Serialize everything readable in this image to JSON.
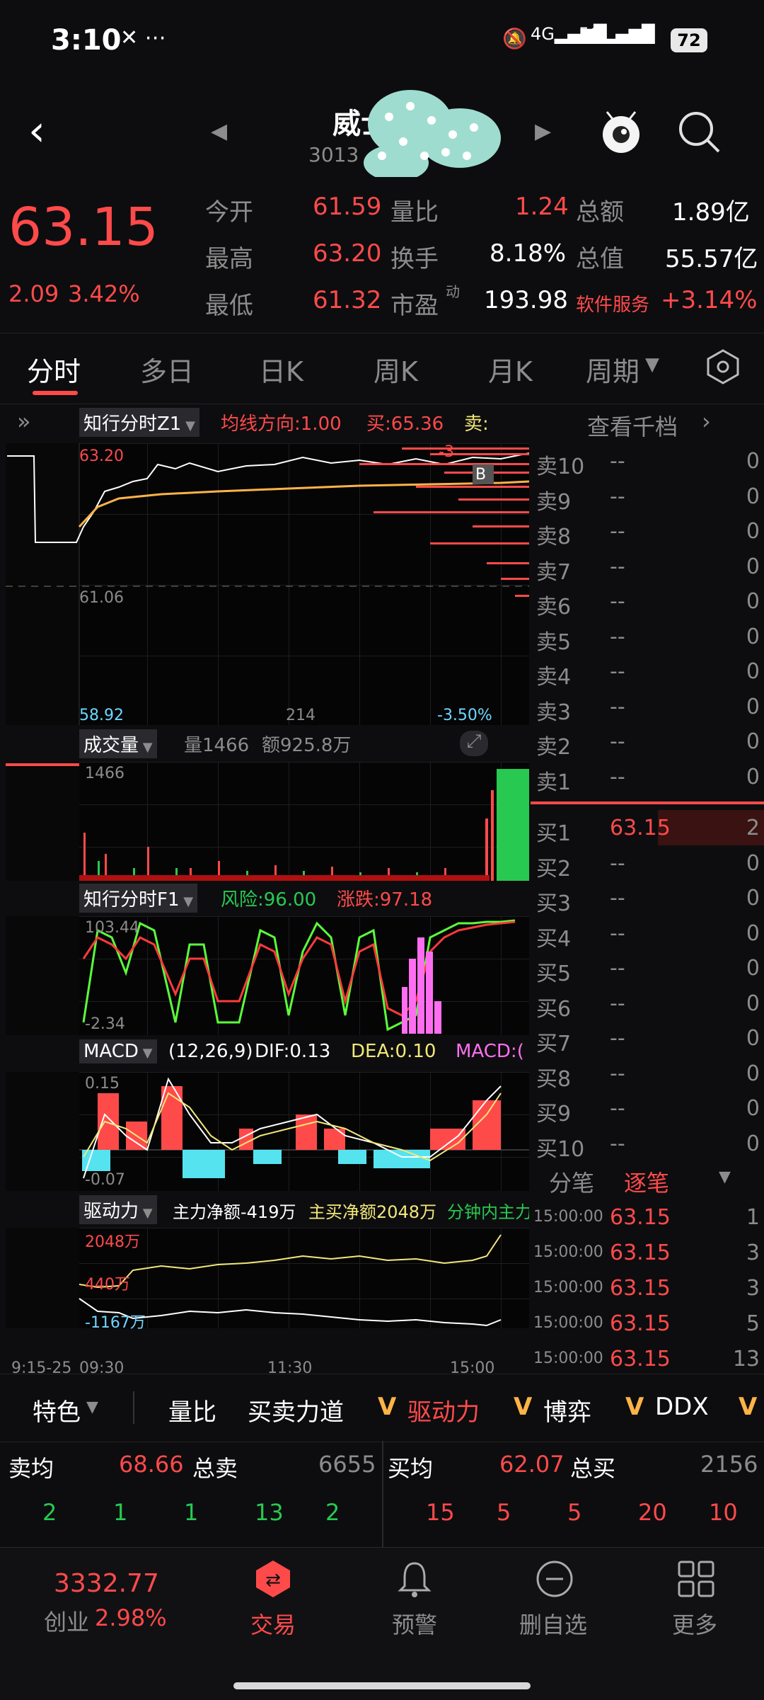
{
  "status": {
    "time": "3:10",
    "battery": "72"
  },
  "nav": {
    "title": "威士",
    "code": "3013"
  },
  "quote": {
    "price": "63.15",
    "change": "2.09",
    "pct": "3.42%",
    "r1": [
      {
        "k": "今开",
        "v": "61.59"
      },
      {
        "k": "量比",
        "v": "1.24"
      },
      {
        "k": "总额",
        "v": "1.89亿"
      }
    ],
    "r2": [
      {
        "k": "最高",
        "v": "63.20"
      },
      {
        "k": "换手",
        "v": "8.18%"
      },
      {
        "k": "总值",
        "v": "55.57亿"
      }
    ],
    "r3": [
      {
        "k": "最低",
        "v": "61.32"
      },
      {
        "k": "市盈",
        "v": "193.98"
      },
      {
        "k": "软件服务",
        "v": "+3.14%"
      }
    ],
    "pe_sup": "动"
  },
  "tabs": [
    "分时",
    "多日",
    "日K",
    "周K",
    "月K",
    "周期"
  ],
  "chart1": {
    "name": "知行分时Z1",
    "avgdir": "均线方向:1.00",
    "buy": "买:65.36",
    "sell": "卖:",
    "view_depth": "查看千档",
    "top": "63.20",
    "mid": "61.06",
    "bottom": "58.92",
    "xmid": "214",
    "pct": "-3.50%",
    "badge": "B",
    "sell_tag": "-3"
  },
  "volume": {
    "name": "成交量",
    "qty": "量1466",
    "amt": "额925.8万",
    "max": "1466"
  },
  "f1": {
    "name": "知行分时F1",
    "risk": "风险:96.00",
    "rise": "涨跌:97.18",
    "top": "103.44",
    "bot": "-2.34"
  },
  "macd": {
    "name": "MACD",
    "params": "(12,26,9)",
    "dif": "DIF:0.13",
    "dea": "DEA:0.10",
    "macd": "MACD:(",
    "top": "0.15",
    "bot": "-0.07"
  },
  "drive": {
    "name": "驱动力",
    "main": "主力净额-419万",
    "mainbuy": "主买净额2048万",
    "minute": "分钟内主力",
    "top": "2048万",
    "mid": "440万",
    "bot": "-1167万"
  },
  "time_axis": [
    "9:15-25",
    "09:30",
    "11:30",
    "15:00"
  ],
  "book": {
    "sell": [
      {
        "l": "卖10",
        "p": "--",
        "v": "0"
      },
      {
        "l": "卖9",
        "p": "--",
        "v": "0"
      },
      {
        "l": "卖8",
        "p": "--",
        "v": "0"
      },
      {
        "l": "卖7",
        "p": "--",
        "v": "0"
      },
      {
        "l": "卖6",
        "p": "--",
        "v": "0"
      },
      {
        "l": "卖5",
        "p": "--",
        "v": "0"
      },
      {
        "l": "卖4",
        "p": "--",
        "v": "0"
      },
      {
        "l": "卖3",
        "p": "--",
        "v": "0"
      },
      {
        "l": "卖2",
        "p": "--",
        "v": "0"
      },
      {
        "l": "卖1",
        "p": "--",
        "v": "0"
      }
    ],
    "buy": [
      {
        "l": "买1",
        "p": "63.15",
        "v": "2"
      },
      {
        "l": "买2",
        "p": "--",
        "v": "0"
      },
      {
        "l": "买3",
        "p": "--",
        "v": "0"
      },
      {
        "l": "买4",
        "p": "--",
        "v": "0"
      },
      {
        "l": "买5",
        "p": "--",
        "v": "0"
      },
      {
        "l": "买6",
        "p": "--",
        "v": "0"
      },
      {
        "l": "买7",
        "p": "--",
        "v": "0"
      },
      {
        "l": "买8",
        "p": "--",
        "v": "0"
      },
      {
        "l": "买9",
        "p": "--",
        "v": "0"
      },
      {
        "l": "买10",
        "p": "--",
        "v": "0"
      }
    ],
    "tab_trades": "分笔",
    "tab_each": "逐笔",
    "ticks": [
      {
        "t": "15:00:00",
        "p": "63.15",
        "v": "1"
      },
      {
        "t": "15:00:00",
        "p": "63.15",
        "v": "3"
      },
      {
        "t": "15:00:00",
        "p": "63.15",
        "v": "3"
      },
      {
        "t": "15:00:00",
        "p": "63.15",
        "v": "5"
      },
      {
        "t": "15:00:00",
        "p": "63.15",
        "v": "13"
      }
    ]
  },
  "features": {
    "special": "特色",
    "items": [
      "量比",
      "买卖力道",
      "驱动力",
      "博弈",
      "DDX"
    ],
    "v": "V"
  },
  "summary": {
    "sell_avg_l": "卖均",
    "sell_avg": "68.66",
    "sell_total_l": "总卖",
    "sell_total": "6655",
    "buy_avg_l": "买均",
    "buy_avg": "62.07",
    "buy_total_l": "总买",
    "buy_total": "2156",
    "row_l": [
      "2",
      "1",
      "1",
      "13",
      "2"
    ],
    "row_r": [
      "15",
      "5",
      "5",
      "20",
      "10"
    ]
  },
  "bottom": {
    "index_val": "3332.77",
    "index_name": "创业",
    "index_pct": "2.98%",
    "trade": "交易",
    "alert": "预警",
    "remove": "删自选",
    "more": "更多"
  },
  "colors": {
    "up": "#ff4a4a",
    "down": "#28c950",
    "avg": "#ffb347",
    "macd_dea": "#f2e87a",
    "accent_pink": "#ff6ef0"
  }
}
